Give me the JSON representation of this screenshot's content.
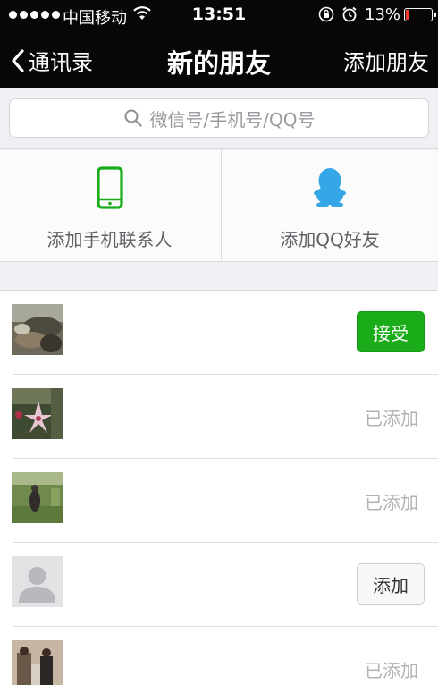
{
  "status_bar": {
    "carrier": "中国移动",
    "time": "13:51",
    "battery": "13%",
    "battery_level": 0.13,
    "signal_icon": "signal-dots-icon",
    "wifi_icon": "wifi-icon",
    "lock_icon": "rotation-lock-icon",
    "alarm_icon": "alarm-icon"
  },
  "nav": {
    "back_label": "通讯录",
    "title": "新的朋友",
    "add_label": "添加朋友",
    "back_icon": "chevron-left-icon"
  },
  "search": {
    "placeholder": "微信号/手机号/QQ号",
    "icon": "search-icon"
  },
  "quick_add": {
    "phone_label": "添加手机联系人",
    "phone_icon": "phone-icon",
    "qq_label": "添加QQ好友",
    "qq_icon": "qq-penguin-icon"
  },
  "friends": [
    {
      "status": "accept",
      "action_label": "接受"
    },
    {
      "status": "added",
      "action_label": "已添加"
    },
    {
      "status": "added",
      "action_label": "已添加"
    },
    {
      "status": "add",
      "action_label": "添加"
    },
    {
      "status": "added",
      "action_label": "已添加"
    }
  ],
  "colors": {
    "bar_background": "#070707",
    "accept_green": "#1aad19",
    "phone_green": "#1aad19",
    "qq_blue": "#35a6e6",
    "battery_red": "#ff3b30"
  }
}
